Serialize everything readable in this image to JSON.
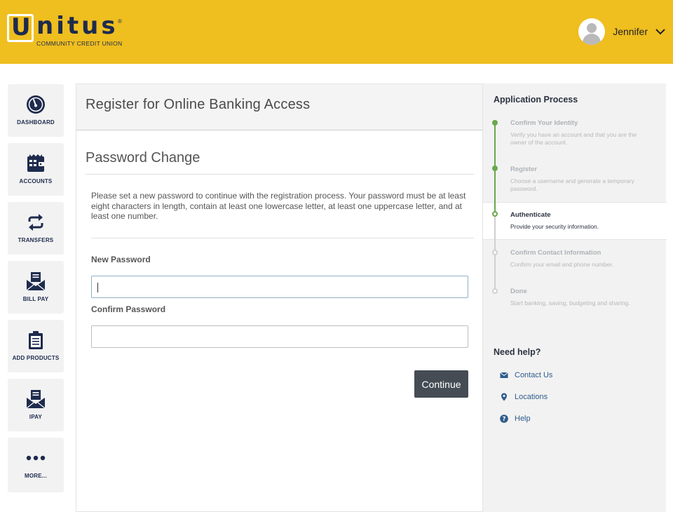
{
  "header": {
    "logo_u": "U",
    "logo_rest": "nitus",
    "logo_reg": "®",
    "tagline": "COMMUNITY CREDIT UNION",
    "user_name": "Jennifer"
  },
  "nav": {
    "items": [
      {
        "label": "DASHBOARD",
        "icon": "gauge-icon"
      },
      {
        "label": "ACCOUNTS",
        "icon": "wallet-icon"
      },
      {
        "label": "TRANSFERS",
        "icon": "transfer-arrows-icon"
      },
      {
        "label": "BILL PAY",
        "icon": "envelope-bill-icon"
      },
      {
        "label": "ADD PRODUCTS",
        "icon": "clipboard-icon"
      },
      {
        "label": "IPAY",
        "icon": "envelope-pay-icon"
      },
      {
        "label": "MORE...",
        "icon": "more-dots-icon"
      }
    ]
  },
  "main": {
    "title": "Register for Online Banking Access",
    "section_title": "Password Change",
    "description": "Please set a new password to continue with the registration process. Your password must be at least eight characters in length, contain at least one lowercase letter, at least one uppercase letter, and at least one number.",
    "new_password_label": "New Password",
    "new_password_value": "",
    "confirm_password_label": "Confirm Password",
    "confirm_password_value": "",
    "continue_label": "Continue"
  },
  "side": {
    "title": "Application Process",
    "steps": [
      {
        "name": "Confirm Your Identity",
        "desc": "Verify you have an account and that you are the owner of the account.",
        "state": "done"
      },
      {
        "name": "Register",
        "desc": "Choose a username and generate a temporary password.",
        "state": "done"
      },
      {
        "name": "Authenticate",
        "desc": "Provide your security information.",
        "state": "current"
      },
      {
        "name": "Confirm Contact Information",
        "desc": "Confirm your email and phone number.",
        "state": "todo"
      },
      {
        "name": "Done",
        "desc": "Start banking, saving, budgeting and sharing.",
        "state": "todo"
      }
    ],
    "help_title": "Need help?",
    "help_links": [
      {
        "label": "Contact Us",
        "icon": "mail-icon"
      },
      {
        "label": "Locations",
        "icon": "map-pin-icon"
      },
      {
        "label": "Help",
        "icon": "question-icon"
      }
    ]
  },
  "colors": {
    "header_bg": "#efbe1f",
    "brand_navy": "#1e2b4d",
    "progress_green": "#6aa84f",
    "button_bg": "#454c54",
    "link_blue": "#2f5b8c"
  }
}
